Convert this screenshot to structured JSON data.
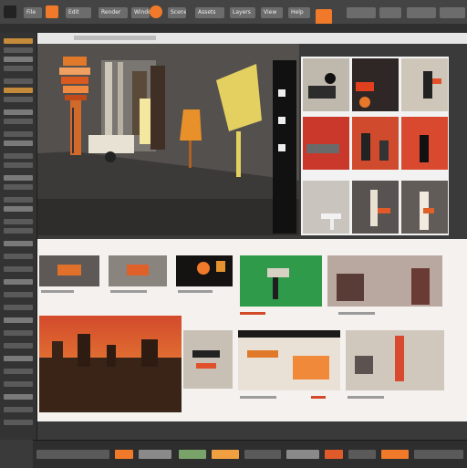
{
  "menu": {
    "items": [
      {
        "label": "File"
      },
      {
        "label": "Edit"
      },
      {
        "label": "Render"
      },
      {
        "label": "Window"
      },
      {
        "label": "Scene"
      },
      {
        "label": "Assets"
      },
      {
        "label": "Layers"
      },
      {
        "label": "View"
      },
      {
        "label": "Help"
      }
    ]
  },
  "colors": {
    "accent": "#f07a2a",
    "green": "#2f9a4a",
    "red": "#c0392b"
  }
}
